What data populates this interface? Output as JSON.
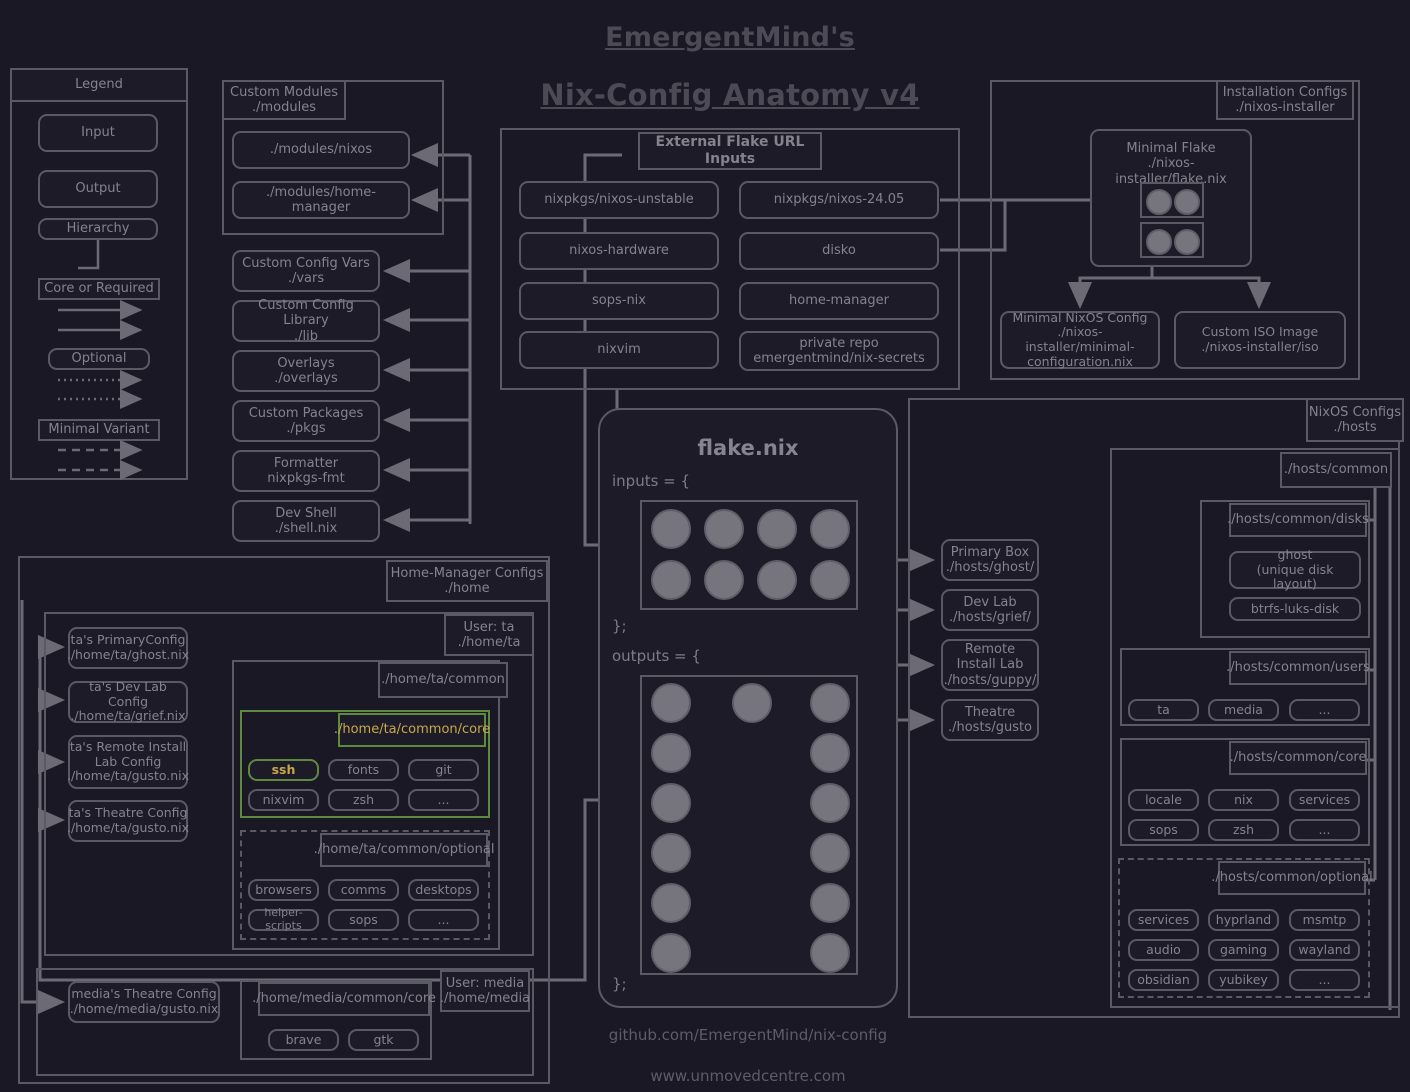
{
  "theme": {
    "bg": "#1a1825",
    "box_bg": "#1d1b28",
    "stroke": "#5a5a64",
    "text": "#84838d",
    "title": "#4b4a55",
    "highlight_border": "#5e8a40",
    "highlight_text": "#c8a84b",
    "circle_fill": "#76757d"
  },
  "title": {
    "line1": "EmergentMind's",
    "line2": "Nix-Config Anatomy v4"
  },
  "footer": {
    "repo": "github.com/EmergentMind/nix-config",
    "site": "www.unmovedcentre.com"
  },
  "legend": {
    "header": "Legend",
    "input": "Input",
    "output": "Output",
    "hierarchy": "Hierarchy",
    "core": "Core or Required",
    "optional": "Optional",
    "minimal": "Minimal Variant"
  },
  "custom_modules": {
    "header": "Custom Modules\n./modules",
    "items": [
      {
        "label": "./modules/nixos"
      },
      {
        "label": "./modules/home-manager"
      }
    ]
  },
  "standalone_inputs": [
    {
      "label": "Custom Config Vars\n./vars"
    },
    {
      "label": "Custom Config Library\n./lib"
    },
    {
      "label": "Overlays\n./overlays"
    },
    {
      "label": "Custom Packages\n./pkgs"
    },
    {
      "label": "Formatter\nnixpkgs-fmt"
    },
    {
      "label": "Dev Shell\n./shell.nix"
    }
  ],
  "external_inputs": {
    "header": "External Flake URL Inputs",
    "left_column": [
      {
        "label": "nixpkgs/nixos-unstable"
      },
      {
        "label": "nixos-hardware"
      },
      {
        "label": "sops-nix"
      },
      {
        "label": "nixvim"
      }
    ],
    "right_column": [
      {
        "label": "nixpkgs/nixos-24.05"
      },
      {
        "label": "disko"
      },
      {
        "label": "home-manager"
      },
      {
        "label": "private repo\nemergentmind/nix-secrets"
      }
    ]
  },
  "installation_configs": {
    "header": "Installation Configs\n./nixos-installer",
    "minimal_flake": {
      "label": "Minimal Flake\n./nixos-installer/flake.nix",
      "inputs_circles": 2,
      "outputs_circles": 2
    },
    "outputs": [
      {
        "label": "Minimal NixOS Config\n./nixos-installer/minimal-configuration.nix"
      },
      {
        "label": "Custom ISO Image\n./nixos-installer/iso"
      }
    ]
  },
  "flake": {
    "title": "flake.nix",
    "inputs_open": "inputs = {",
    "inputs_close": "};",
    "outputs_open": "outputs = {",
    "outputs_close": "};",
    "inputs_grid": {
      "cols": 4,
      "rows": 2,
      "count": 8
    },
    "outputs_grid": {
      "rows": 6,
      "left_count": 6,
      "right_count": 6,
      "middle_count": 1
    }
  },
  "hosts_outputs": [
    {
      "label": "Primary Box\n./hosts/ghost/"
    },
    {
      "label": "Dev Lab\n./hosts/grief/"
    },
    {
      "label": "Remote Install Lab\n./hosts/guppy/"
    },
    {
      "label": "Theatre\n./hosts/gusto"
    }
  ],
  "nixos_configs": {
    "header": "NixOS Configs\n./hosts",
    "common_header": "./hosts/common",
    "groups": [
      {
        "header": "./hosts/common/disks",
        "style": "solid",
        "items": [
          {
            "label": "ghost\n(unique disk layout)",
            "wide": true
          },
          {
            "label": "btrfs-luks-disk",
            "wide": true
          }
        ]
      },
      {
        "header": "./hosts/common/users",
        "style": "solid",
        "items": [
          {
            "label": "ta"
          },
          {
            "label": "media"
          },
          {
            "label": "..."
          }
        ]
      },
      {
        "header": "./hosts/common/core",
        "style": "solid",
        "items": [
          {
            "label": "locale"
          },
          {
            "label": "nix"
          },
          {
            "label": "services"
          },
          {
            "label": "sops"
          },
          {
            "label": "zsh"
          },
          {
            "label": "..."
          }
        ]
      },
      {
        "header": "./hosts/common/optional",
        "style": "dashed",
        "items": [
          {
            "label": "services"
          },
          {
            "label": "hyprland"
          },
          {
            "label": "msmtp"
          },
          {
            "label": "audio"
          },
          {
            "label": "gaming"
          },
          {
            "label": "wayland"
          },
          {
            "label": "obsidian"
          },
          {
            "label": "yubikey"
          },
          {
            "label": "..."
          }
        ]
      }
    ]
  },
  "home_manager": {
    "header": "Home-Manager Configs\n./home",
    "user_ta": {
      "header": "User: ta\n./home/ta",
      "configs": [
        {
          "label": "ta's PrimaryConfig\n./home/ta/ghost.nix"
        },
        {
          "label": "ta's Dev Lab Config\n./home/ta/grief.nix"
        },
        {
          "label": "ta's Remote Install Lab Config\n./home/ta/gusto.nix"
        },
        {
          "label": "ta's Theatre Config\n./home/ta/gusto.nix"
        }
      ],
      "common_header": "./home/ta/common",
      "groups": [
        {
          "header": "./home/ta/common/core",
          "style": "solid",
          "highlight": true,
          "items": [
            {
              "label": "ssh",
              "highlight": true
            },
            {
              "label": "fonts"
            },
            {
              "label": "git"
            },
            {
              "label": "nixvim"
            },
            {
              "label": "zsh"
            },
            {
              "label": "..."
            }
          ]
        },
        {
          "header": "./home/ta/common/optional",
          "style": "dashed",
          "items": [
            {
              "label": "browsers"
            },
            {
              "label": "comms"
            },
            {
              "label": "desktops"
            },
            {
              "label": "helper-scripts"
            },
            {
              "label": "sops"
            },
            {
              "label": "..."
            }
          ]
        }
      ]
    },
    "user_media": {
      "header": "User: media\n./home/media",
      "configs": [
        {
          "label": "media's Theatre Config\n./home/media/gusto.nix"
        }
      ],
      "core_header": "./home/media/common/core",
      "items": [
        {
          "label": "brave"
        },
        {
          "label": "gtk"
        }
      ]
    }
  }
}
